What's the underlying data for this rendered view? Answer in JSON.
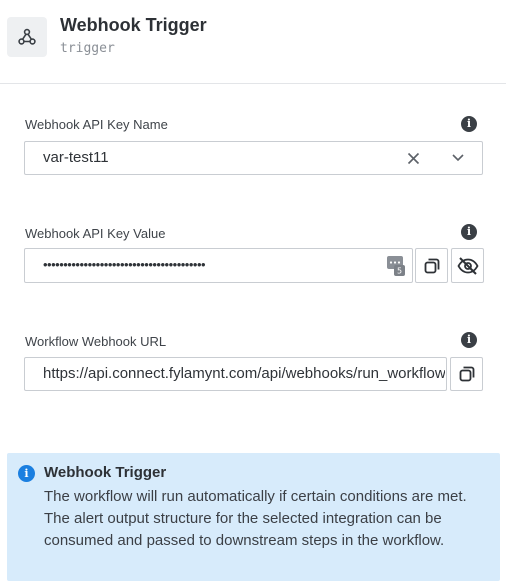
{
  "header": {
    "title": "Webhook Trigger",
    "subtitle": "trigger",
    "icon": "webhook-icon"
  },
  "fields": {
    "key_name": {
      "label": "Webhook API Key Name",
      "value": "var-test11"
    },
    "key_value": {
      "label": "Webhook API Key Value",
      "value": "••••••••••••••••••••••••••••••••••••••••"
    },
    "webhook_url": {
      "label": "Workflow Webhook URL",
      "value": "https://api.connect.fylamynt.com/api/webhooks/run_workflow"
    }
  },
  "banner": {
    "title": "Webhook Trigger",
    "body": "The workflow will run automatically if certain conditions are met. The alert output structure for the selected integration can be consumed and passed to downstream steps in the workflow."
  },
  "colors": {
    "banner_bg": "#d7ebfb",
    "info_blue": "#1b7fe0"
  }
}
